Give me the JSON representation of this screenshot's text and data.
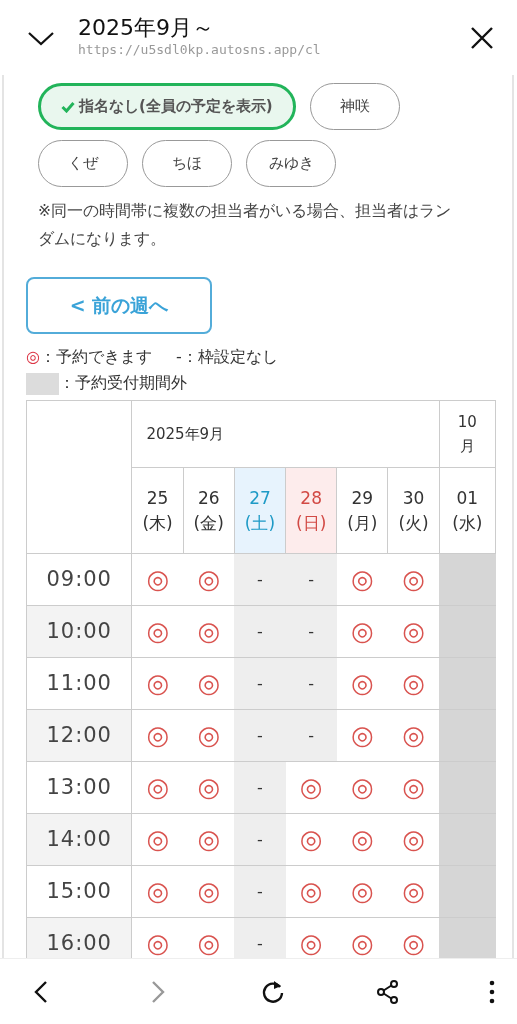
{
  "top_bar": {
    "title": "2025年9月～",
    "url": "https://u5sdl0kp.autosns.app/cl"
  },
  "staff_filters": [
    {
      "label": "指名なし(全員の予定を表示)",
      "selected": true
    },
    {
      "label": "神咲",
      "selected": false
    },
    {
      "label": "くぜ",
      "selected": false
    },
    {
      "label": "ちほ",
      "selected": false
    },
    {
      "label": "みゆき",
      "selected": false
    }
  ],
  "note": "※同一の時間帯に複数の担当者がいる場合、担当者はランダムになります。",
  "prev_week_button": "< 前の週へ",
  "legend": [
    {
      "kind": "available",
      "symbol": "◎",
      "label": "：予約できます"
    },
    {
      "kind": "none",
      "symbol": "-",
      "label": "：枠設定なし"
    },
    {
      "kind": "closed",
      "label": "：予約受付期間外"
    }
  ],
  "calendar": {
    "months": [
      {
        "label": "2025年9月"
      },
      {
        "label": "10月"
      }
    ],
    "days": [
      {
        "date": "25",
        "weekday": "(木)",
        "kind": "weekday"
      },
      {
        "date": "26",
        "weekday": "(金)",
        "kind": "weekday"
      },
      {
        "date": "27",
        "weekday": "(土)",
        "kind": "saturday"
      },
      {
        "date": "28",
        "weekday": "(日)",
        "kind": "sunday"
      },
      {
        "date": "29",
        "weekday": "(月)",
        "kind": "weekday"
      },
      {
        "date": "30",
        "weekday": "(火)",
        "kind": "weekday"
      },
      {
        "date": "01",
        "weekday": "(水)",
        "kind": "weekday"
      }
    ],
    "rows": [
      {
        "time": "09:00",
        "cells": [
          {
            "kind": "available",
            "text": "◎"
          },
          {
            "kind": "available",
            "text": "◎"
          },
          {
            "kind": "none",
            "text": "-"
          },
          {
            "kind": "none",
            "text": "-"
          },
          {
            "kind": "available",
            "text": "◎"
          },
          {
            "kind": "available",
            "text": "◎"
          },
          {
            "kind": "closed"
          }
        ]
      },
      {
        "time": "10:00",
        "cells": [
          {
            "kind": "available",
            "text": "◎"
          },
          {
            "kind": "available",
            "text": "◎"
          },
          {
            "kind": "none",
            "text": "-"
          },
          {
            "kind": "none",
            "text": "-"
          },
          {
            "kind": "available",
            "text": "◎"
          },
          {
            "kind": "available",
            "text": "◎"
          },
          {
            "kind": "closed"
          }
        ]
      },
      {
        "time": "11:00",
        "cells": [
          {
            "kind": "available",
            "text": "◎"
          },
          {
            "kind": "available",
            "text": "◎"
          },
          {
            "kind": "none",
            "text": "-"
          },
          {
            "kind": "none",
            "text": "-"
          },
          {
            "kind": "available",
            "text": "◎"
          },
          {
            "kind": "available",
            "text": "◎"
          },
          {
            "kind": "closed"
          }
        ]
      },
      {
        "time": "12:00",
        "cells": [
          {
            "kind": "available",
            "text": "◎"
          },
          {
            "kind": "available",
            "text": "◎"
          },
          {
            "kind": "none",
            "text": "-"
          },
          {
            "kind": "none",
            "text": "-"
          },
          {
            "kind": "available",
            "text": "◎"
          },
          {
            "kind": "available",
            "text": "◎"
          },
          {
            "kind": "closed"
          }
        ]
      },
      {
        "time": "13:00",
        "cells": [
          {
            "kind": "available",
            "text": "◎"
          },
          {
            "kind": "available",
            "text": "◎"
          },
          {
            "kind": "none",
            "text": "-"
          },
          {
            "kind": "available",
            "text": "◎"
          },
          {
            "kind": "available",
            "text": "◎"
          },
          {
            "kind": "available",
            "text": "◎"
          },
          {
            "kind": "closed"
          }
        ]
      },
      {
        "time": "14:00",
        "cells": [
          {
            "kind": "available",
            "text": "◎"
          },
          {
            "kind": "available",
            "text": "◎"
          },
          {
            "kind": "none",
            "text": "-"
          },
          {
            "kind": "available",
            "text": "◎"
          },
          {
            "kind": "available",
            "text": "◎"
          },
          {
            "kind": "available",
            "text": "◎"
          },
          {
            "kind": "closed"
          }
        ]
      },
      {
        "time": "15:00",
        "cells": [
          {
            "kind": "available",
            "text": "◎"
          },
          {
            "kind": "available",
            "text": "◎"
          },
          {
            "kind": "none",
            "text": "-"
          },
          {
            "kind": "available",
            "text": "◎"
          },
          {
            "kind": "available",
            "text": "◎"
          },
          {
            "kind": "available",
            "text": "◎"
          },
          {
            "kind": "closed"
          }
        ]
      },
      {
        "time": "16:00",
        "cells": [
          {
            "kind": "available",
            "text": "◎"
          },
          {
            "kind": "available",
            "text": "◎"
          },
          {
            "kind": "none",
            "text": "-"
          },
          {
            "kind": "available",
            "text": "◎"
          },
          {
            "kind": "available",
            "text": "◎"
          },
          {
            "kind": "available",
            "text": "◎"
          },
          {
            "kind": "closed"
          }
        ]
      }
    ]
  },
  "bottom_bar": [
    {
      "kind": "back",
      "disabled": false
    },
    {
      "kind": "forward",
      "disabled": true
    },
    {
      "kind": "reload",
      "disabled": false
    },
    {
      "kind": "share",
      "disabled": false
    },
    {
      "kind": "more",
      "disabled": false
    }
  ]
}
